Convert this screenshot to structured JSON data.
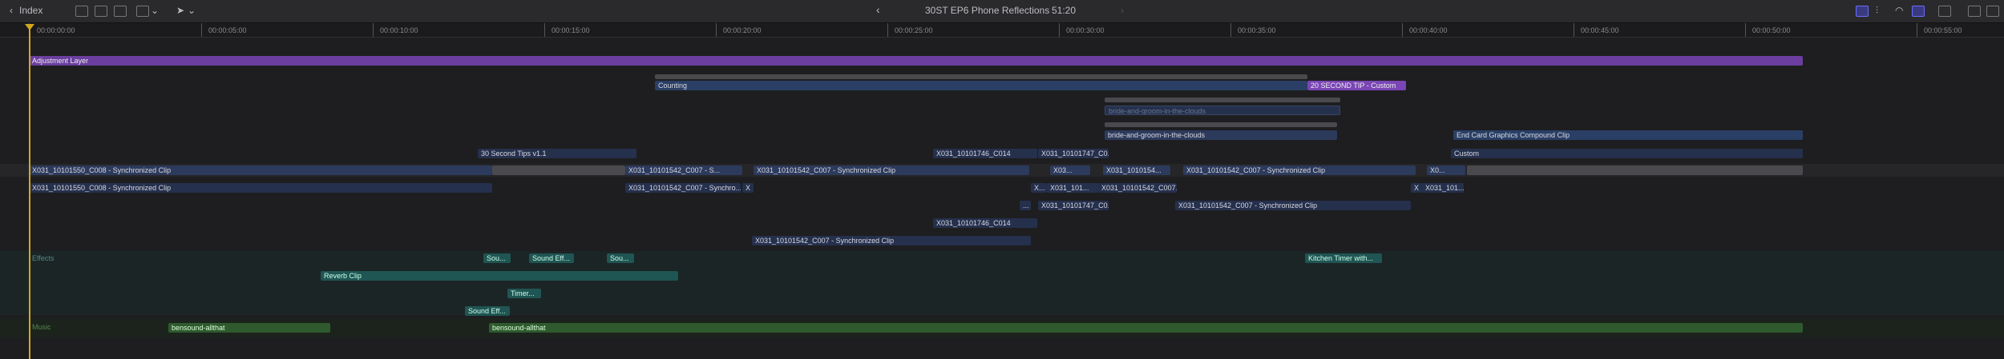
{
  "toolbar": {
    "index_label": "Index",
    "project_title": "30ST EP6 Phone Reflections",
    "duration": "51:20"
  },
  "ruler": {
    "ticks": [
      "00:00:00:00",
      "00:00:05:00",
      "00:00:10:00",
      "00:00:15:00",
      "00:00:20:00",
      "00:00:25:00",
      "00:00:30:00",
      "00:00:35:00",
      "00:00:40:00",
      "00:00:45:00",
      "00:00:50:00",
      "00:00:55:00"
    ]
  },
  "clips": {
    "adjustment": "Adjustment Layer",
    "counting": "Counting",
    "tip_custom": "20 SECOND TIP - Custom",
    "bride1": "bride-and-groom-in-the-clouds",
    "bride2": "bride-and-groom-in-the-clouds",
    "end_card": "End Card Graphics Compound Clip",
    "tips": "30 Second Tips v1.1",
    "c014_a": "X031_10101746_C014",
    "c007_a": "X031_10101747_C0...",
    "custom": "Custom",
    "sync1": "X031_10101550_C008 - Synchronized Clip",
    "sync2": "X031_10101542_C007 - S...",
    "sync3": "X031_10101542_C007 - Synchronized Clip",
    "sync4": "X03...",
    "sync5": "X031_1010154...",
    "sync6": "X031_10101542_C007 - Synchronized Clip",
    "sync7": "X0...",
    "r2_1": "X031_10101550_C008 - Synchronized Clip",
    "r2_2": "X031_10101542_C007 - Synchro...",
    "r2_3": "X",
    "r2_4": "X...",
    "r2_5": "X031_101...",
    "r2_6": "X031_10101542_C007...",
    "r2_7": "X",
    "r2_8": "X031_101...",
    "r3_1": "...",
    "r3_2": "X031_10101747_C0...",
    "r3_3": "X031_10101542_C007 - Synchronized Clip",
    "r4_1": "X031_10101746_C014",
    "r5_1": "X031_10101542_C007 - Synchronized Clip",
    "effects_label": "Effects",
    "sou1": "Sou...",
    "sound_eff1": "Sound Eff...",
    "sou2": "Sou...",
    "kitchen": "Kitchen Timer with...",
    "reverb": "Reverb Clip",
    "timer": "Timer...",
    "sound_eff2": "Sound Eff...",
    "music_label": "Music",
    "music1": "bensound-allthat",
    "music2": "bensound-allthat"
  },
  "colors": {
    "playhead": "#d4a81c",
    "video": "#2c3a5c",
    "adjustment": "#6b3ea0",
    "effects": "#1f5552",
    "music": "#2f5a2e"
  }
}
